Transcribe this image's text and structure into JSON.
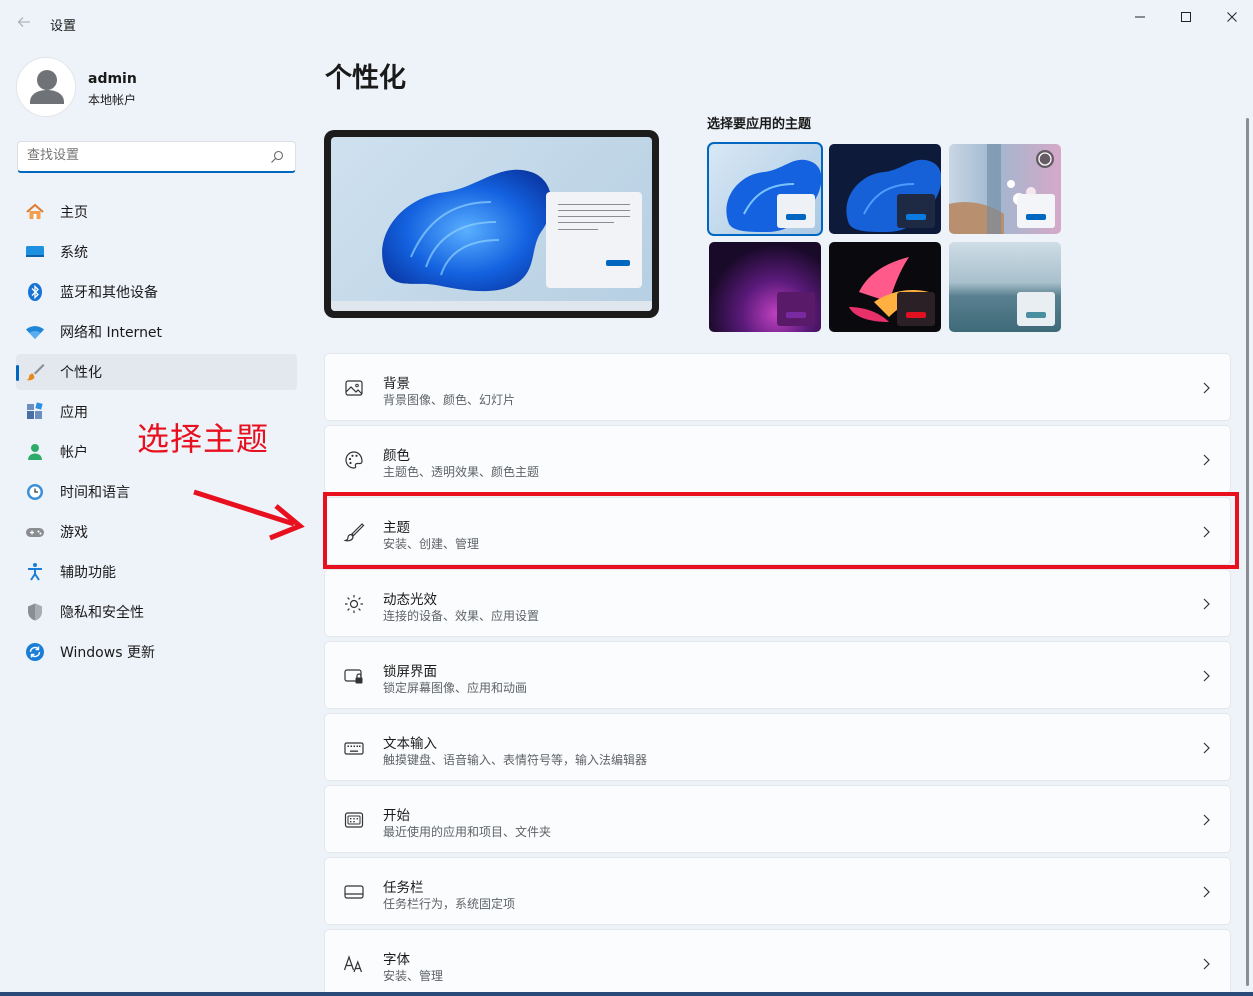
{
  "window": {
    "title": "设置",
    "back_icon": "back-arrow-icon",
    "controls": [
      "minimize-icon",
      "maximize-icon",
      "close-icon"
    ]
  },
  "profile": {
    "name": "admin",
    "account_type": "本地帐户"
  },
  "search": {
    "placeholder": "查找设置",
    "icon": "search-icon"
  },
  "sidebar": {
    "items": [
      {
        "label": "主页",
        "icon": "home-icon",
        "active": false
      },
      {
        "label": "系统",
        "icon": "system-icon",
        "active": false
      },
      {
        "label": "蓝牙和其他设备",
        "icon": "bluetooth-icon",
        "active": false
      },
      {
        "label": "网络和 Internet",
        "icon": "wifi-icon",
        "active": false
      },
      {
        "label": "个性化",
        "icon": "brush-icon",
        "active": true
      },
      {
        "label": "应用",
        "icon": "apps-icon",
        "active": false
      },
      {
        "label": "帐户",
        "icon": "account-icon",
        "active": false
      },
      {
        "label": "时间和语言",
        "icon": "time-language-icon",
        "active": false
      },
      {
        "label": "游戏",
        "icon": "gamepad-icon",
        "active": false
      },
      {
        "label": "辅助功能",
        "icon": "accessibility-icon",
        "active": false
      },
      {
        "label": "隐私和安全性",
        "icon": "shield-icon",
        "active": false
      },
      {
        "label": "Windows 更新",
        "icon": "update-icon",
        "active": false
      }
    ]
  },
  "main": {
    "title": "个性化",
    "themes_label": "选择要应用的主题",
    "themes": [
      {
        "id": "windows-light",
        "selected": true
      },
      {
        "id": "windows-dark",
        "selected": false
      },
      {
        "id": "spotlight",
        "selected": false
      },
      {
        "id": "glow",
        "selected": false
      },
      {
        "id": "captured-motion",
        "selected": false
      },
      {
        "id": "flow",
        "selected": false
      }
    ],
    "rows": [
      {
        "title": "背景",
        "subtitle": "背景图像、颜色、幻灯片",
        "icon": "image-icon"
      },
      {
        "title": "颜色",
        "subtitle": "主题色、透明效果、颜色主题",
        "icon": "palette-icon"
      },
      {
        "title": "主题",
        "subtitle": "安装、创建、管理",
        "icon": "brush-icon"
      },
      {
        "title": "动态光效",
        "subtitle": "连接的设备、效果、应用设置",
        "icon": "lighting-icon"
      },
      {
        "title": "锁屏界面",
        "subtitle": "锁定屏幕图像、应用和动画",
        "icon": "lock-screen-icon"
      },
      {
        "title": "文本输入",
        "subtitle": "触摸键盘、语音输入、表情符号等，输入法编辑器",
        "icon": "keyboard-icon"
      },
      {
        "title": "开始",
        "subtitle": "最近使用的应用和项目、文件夹",
        "icon": "start-icon"
      },
      {
        "title": "任务栏",
        "subtitle": "任务栏行为，系统固定项",
        "icon": "taskbar-icon"
      },
      {
        "title": "字体",
        "subtitle": "安装、管理",
        "icon": "fonts-icon"
      }
    ]
  },
  "annotation": {
    "text": "选择主题",
    "color": "#e8101e"
  },
  "colors": {
    "accent": "#0067c0",
    "background": "#eef3f9"
  }
}
